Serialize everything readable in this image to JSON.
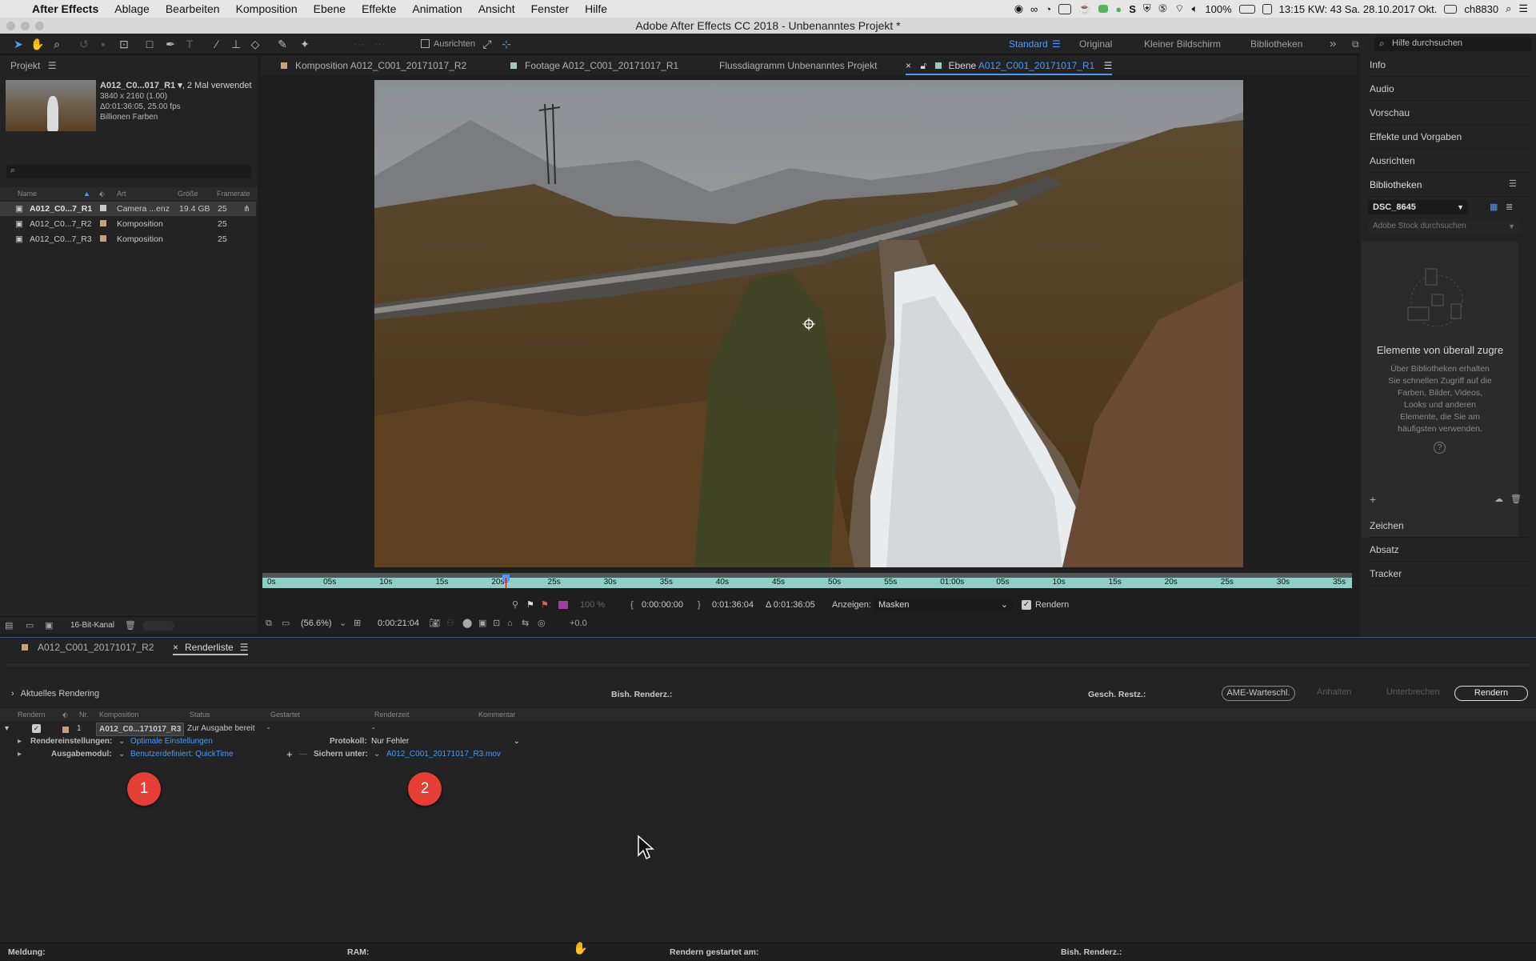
{
  "menubar": {
    "app": "After Effects",
    "items": [
      "Ablage",
      "Bearbeiten",
      "Komposition",
      "Ebene",
      "Effekte",
      "Animation",
      "Ansicht",
      "Fenster",
      "Hilfe"
    ],
    "battery": "100%",
    "clock": "13:15 KW: 43 Sa. 28.10.2017 Okt.",
    "user": "ch8830"
  },
  "window_title": "Adobe After Effects CC 2018 - Unbenanntes Projekt *",
  "toolbar": {
    "align_label": "Ausrichten",
    "workspaces": [
      "Standard",
      "Original",
      "Kleiner Bildschirm",
      "Bibliotheken"
    ],
    "search_placeholder": "Hilfe durchsuchen"
  },
  "project": {
    "tab": "Projekt",
    "selected_name": "A012_C0...017_R1 ▾",
    "used": ", 2 Mal verwendet",
    "info_lines": [
      "3840 x 2160 (1.00)",
      "Δ0:01:36:05, 25.00 fps",
      "Billionen Farben"
    ],
    "columns": [
      "Name",
      "Art",
      "Größe",
      "Framerate"
    ],
    "rows": [
      {
        "name": "A012_C0...7_R1",
        "type": "Camera ...enz",
        "size": "19.4 GB",
        "fps": "25",
        "color": "#c9c9c9"
      },
      {
        "name": "A012_C0...7_R2",
        "type": "Komposition",
        "size": "",
        "fps": "25",
        "color": "#c4a37c"
      },
      {
        "name": "A012_C0...7_R3",
        "type": "Komposition",
        "size": "",
        "fps": "25",
        "color": "#c4a37c"
      }
    ],
    "bitdepth": "16-Bit-Kanal"
  },
  "viewer_tabs": [
    {
      "label": "Komposition A012_C001_20171017_R2",
      "color": "#c4a37c"
    },
    {
      "label": "Footage A012_C001_20171017_R1",
      "color": "#9fc8c0"
    },
    {
      "label": "Flussdiagramm Unbenanntes Projekt",
      "color": ""
    },
    {
      "label_prefix": "Ebene ",
      "label_blue": "A012_C001_20171017_R1",
      "color": "#9fc8c0"
    }
  ],
  "timeline": {
    "ticks": [
      "0s",
      "05s",
      "10s",
      "15s",
      "20s",
      "25s",
      "30s",
      "35s",
      "40s",
      "45s",
      "50s",
      "55s",
      "01:00s",
      "05s",
      "10s",
      "15s",
      "20s",
      "25s",
      "30s",
      "35s"
    ],
    "tc_in": "0:00:00:00",
    "tc_out": "0:01:36:04",
    "tc_dur": "Δ 0:01:36:05",
    "opacity": "100 %",
    "show_label": "Anzeigen:",
    "show_value": "Masken",
    "render_label": "Rendern",
    "zoom": "(56.6%)",
    "current_time": "0:00:21:04",
    "exposure": "+0.0"
  },
  "right_panel": {
    "items_top": [
      "Info",
      "Audio",
      "Vorschau",
      "Effekte und Vorgaben",
      "Ausrichten",
      "Bibliotheken"
    ],
    "library_select": "DSC_8645",
    "stock_placeholder": "Adobe Stock durchsuchen",
    "empty_title": "Elemente von überall zugre",
    "empty_text": [
      "Über Bibliotheken erhalten",
      "Sie schnellen Zugriff auf die",
      "Farben, Bilder, Videos,",
      "Looks und anderen",
      "Elemente, die Sie am",
      "häufigsten verwenden."
    ],
    "items_bottom": [
      "Zeichen",
      "Absatz",
      "Tracker"
    ]
  },
  "render_queue": {
    "tabs": [
      "A012_C001_20171017_R2",
      "Renderliste"
    ],
    "current_rendering": "Aktuelles Rendering",
    "elapsed": "Bish. Renderz.:",
    "remaining": "Gesch. Restz.:",
    "btn_ame": "AME-Warteschl.",
    "btn_pause": "Anhalten",
    "btn_stop": "Unterbrechen",
    "btn_render": "Rendern",
    "columns": [
      "Rendern",
      "Nr.",
      "Komposition",
      "Status",
      "Gestartet",
      "Renderzeit",
      "Kommentar"
    ],
    "item": {
      "nr": "1",
      "comp": "A012_C0...171017_R3",
      "status": "Zur Ausgabe bereit",
      "started": "-",
      "rendertime": "-"
    },
    "render_settings_label": "Rendereinstellungen:",
    "render_settings_value": "Optimale Einstellungen",
    "output_module_label": "Ausgabemodul:",
    "output_module_value": "Benutzerdefiniert: QuickTime",
    "log_label": "Protokoll:",
    "log_value": "Nur Fehler",
    "save_label": "Sichern unter:",
    "save_value": "A012_C001_20171017_R3.mov",
    "callouts": [
      "1",
      "2"
    ]
  },
  "statusbar": {
    "message": "Meldung:",
    "ram": "RAM:",
    "started": "Rendern gestartet am:",
    "elapsed": "Bish. Renderz.:"
  }
}
